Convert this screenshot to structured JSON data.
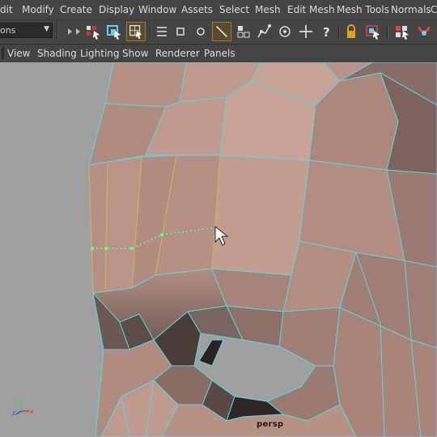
{
  "menubar": {
    "items": [
      "dit",
      "Modify",
      "Create",
      "Display",
      "Window",
      "Assets",
      "Select",
      "Mesh",
      "Edit Mesh",
      "Mesh Tools",
      "Normals",
      "C"
    ]
  },
  "toolbar": {
    "mode_value": "ons",
    "icons": [
      "vertex-select-icon",
      "face-select-icon",
      "object-select-icon",
      "move-tool-icon",
      "scale-tool-icon",
      "rotate-tool-icon",
      "edge-tool-icon",
      "soft-select-icon",
      "snap-grid-icon",
      "help-icon",
      "lock-icon",
      "select-camera-icon",
      "snap-curve-icon",
      "snap-point-icon"
    ]
  },
  "panel_menu": {
    "items": [
      "View",
      "Shading",
      "Lighting",
      "Show",
      "Renderer",
      "Panels"
    ]
  },
  "viewport": {
    "camera_label": "persp",
    "axis": {
      "y": "y",
      "z": "z",
      "x": "x"
    },
    "colors": {
      "background": "#a0a0a0",
      "mesh_skin": "#c7a094",
      "mesh_shadow": "#5a4a48",
      "wire": "#5ed4e2",
      "selected_edge": "#f0a050",
      "edge_path": "#5dff88"
    }
  }
}
